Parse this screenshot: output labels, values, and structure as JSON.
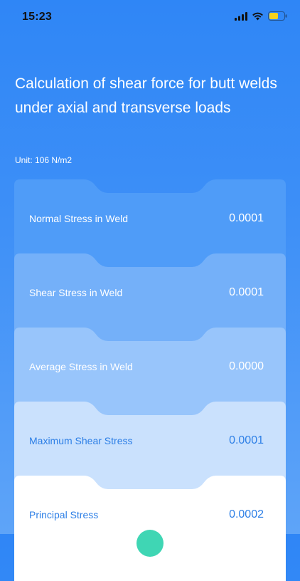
{
  "status_bar": {
    "time": "15:23"
  },
  "header": {
    "title": "Calculation of shear force for butt welds under axial and transverse loads",
    "unit": "Unit: 106 N/m2"
  },
  "results": [
    {
      "label": "Normal Stress in Weld",
      "value": "0.0001",
      "color": "#4f9cf8"
    },
    {
      "label": "Shear Stress in Weld",
      "value": "0.0001",
      "color": "#74b0f9"
    },
    {
      "label": "Average Stress in Weld",
      "value": "0.0000",
      "color": "#98c5fb"
    },
    {
      "label": "Maximum Shear Stress",
      "value": "0.0001",
      "color": "#cae1fd"
    },
    {
      "label": "Principal Stress",
      "value": "0.0002",
      "color": "#ffffff"
    }
  ],
  "colors": {
    "background_top": "#2f86f6",
    "accent_text": "#2d7fe6",
    "fab": "#3fd6b4"
  }
}
